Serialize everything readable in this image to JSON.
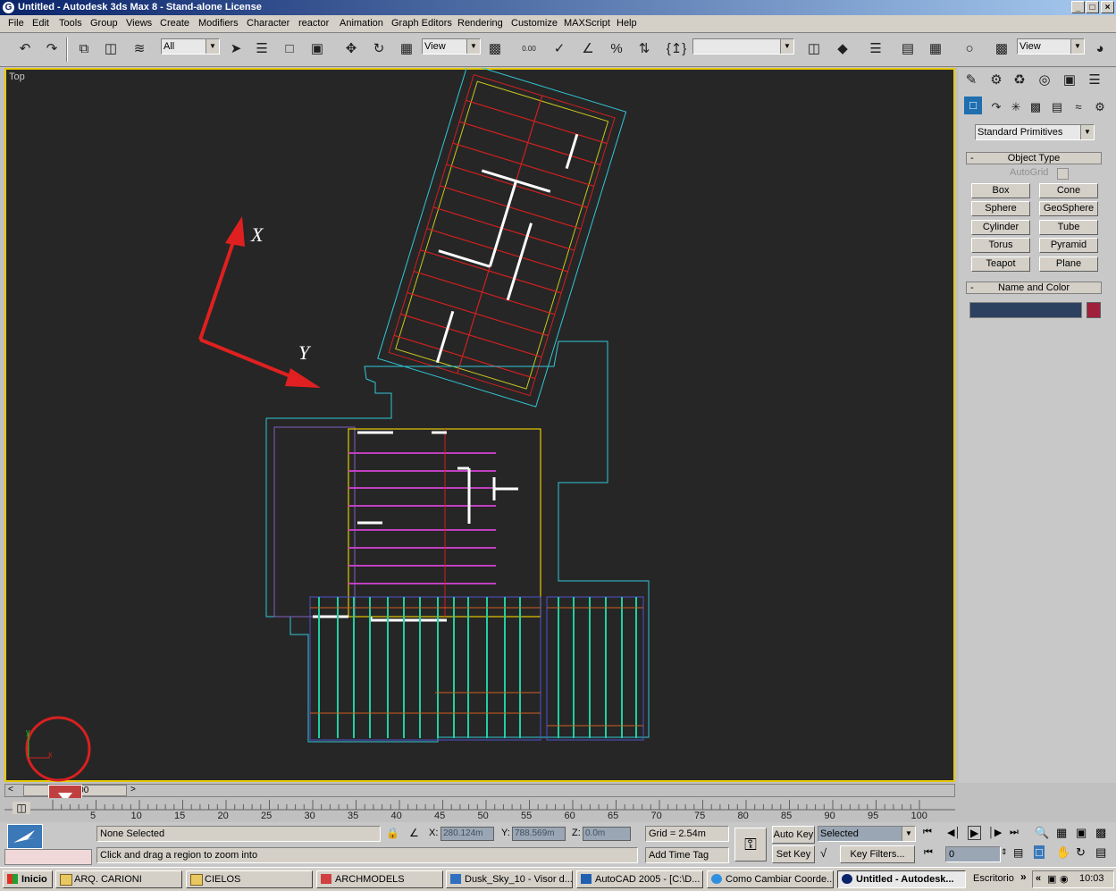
{
  "window": {
    "title": "Untitled - Autodesk 3ds Max 8  - Stand-alone License",
    "minimize": "_",
    "maximize": "□",
    "close": "×"
  },
  "menu": [
    "File",
    "Edit",
    "Tools",
    "Group",
    "Views",
    "Create",
    "Modifiers",
    "Character",
    "reactor",
    "Animation",
    "Graph Editors",
    "Rendering",
    "Customize",
    "MAXScript",
    "Help"
  ],
  "toolbar": {
    "selection_filter": "All",
    "ref_coord": "View",
    "spinner_label": "0.00",
    "named_selection": "",
    "view_dropdown": "View"
  },
  "viewport": {
    "label": "Top",
    "axis_x_label": "X",
    "axis_y_label": "Y",
    "gizmo_x": "x",
    "gizmo_y": "y"
  },
  "command_panel": {
    "category": "Standard Primitives",
    "object_type_title": "Object Type",
    "autogrid": "AutoGrid",
    "buttons": [
      "Box",
      "Cone",
      "Sphere",
      "GeoSphere",
      "Cylinder",
      "Tube",
      "Torus",
      "Pyramid",
      "Teapot",
      "Plane"
    ],
    "name_color_title": "Name and Color",
    "name_value": "",
    "object_color": "#a0203c",
    "collapse_symbol": "-"
  },
  "time_slider": {
    "frame_label": "0 / 100",
    "prev": "<",
    "next": ">"
  },
  "track": {
    "ticks": [
      "5",
      "10",
      "15",
      "20",
      "25",
      "30",
      "35",
      "40",
      "45",
      "50",
      "55",
      "60",
      "65",
      "70",
      "75",
      "80",
      "85",
      "90",
      "95",
      "100"
    ]
  },
  "status": {
    "selection": "None Selected",
    "prompt": "Click and drag a region to zoom into",
    "x_label": "X:",
    "x_value": "280.124m",
    "y_label": "Y:",
    "y_value": "788.569m",
    "z_label": "Z:",
    "z_value": "0.0m",
    "grid": "Grid = 2.54m",
    "add_time_tag": "Add Time Tag",
    "auto_key": "Auto Key",
    "set_key": "Set Key",
    "key_mode": "Selected",
    "key_filters": "Key Filters...",
    "frame": "0"
  },
  "taskbar": {
    "start": "Inicio",
    "tasks": [
      "ARQ. CARIONI",
      "CIELOS",
      "ARCHMODELS",
      "Dusk_Sky_10 - Visor d...",
      "AutoCAD 2005 - [C:\\D...",
      "Como Cambiar Coorde...",
      "Untitled - Autodesk..."
    ],
    "desktop": "Escritorio",
    "chevron": "»",
    "tray_chevron": "«",
    "clock": "10:03"
  },
  "colors": {
    "viewport_bg": "#262626",
    "viewport_border": "#e6c800",
    "axis_arrow": "#e02020",
    "outline": "#30c8d8",
    "stair_green": "#20d0a0",
    "red_lines": "#d02020",
    "magenta_lines": "#c040c0"
  }
}
